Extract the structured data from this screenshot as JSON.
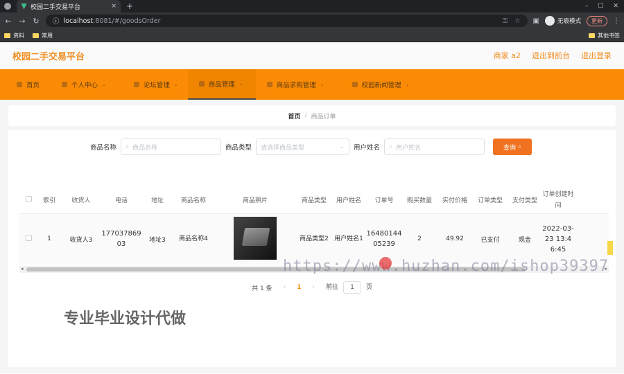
{
  "browser": {
    "tab_title": "校园二手交易平台",
    "tab_close": "×",
    "new_tab": "+",
    "url_host": "localhost",
    "url_path": ":8081/#/goodsOrder",
    "incognito": "无痕模式",
    "update": "更新",
    "bookmarks": [
      "资料",
      "常用"
    ],
    "other_bookmarks": "其他书签"
  },
  "header": {
    "title": "校园二手交易平台",
    "user": "商家 a2",
    "back_front": "退出到前台",
    "logout": "退出登录"
  },
  "nav": [
    {
      "label": "首页"
    },
    {
      "label": "个人中心"
    },
    {
      "label": "论坛管理"
    },
    {
      "label": "商品管理"
    },
    {
      "label": "商品求购管理"
    },
    {
      "label": "校园新闻管理"
    }
  ],
  "breadcrumb": {
    "home": "首页",
    "sep": "/",
    "current": "商品订单"
  },
  "filters": {
    "goods_name_label": "商品名称",
    "goods_name_placeholder": "商品名称",
    "goods_type_label": "商品类型",
    "goods_type_placeholder": "请选择商品类型",
    "user_name_label": "用户姓名",
    "user_name_placeholder": "用户姓名",
    "query_button": "查询"
  },
  "table": {
    "columns": [
      "索引",
      "收货人",
      "电话",
      "地址",
      "商品名称",
      "商品照片",
      "商品类型",
      "用户姓名",
      "订单号",
      "购买数量",
      "实付价格",
      "订单类型",
      "支付类型",
      "订单创建时间"
    ],
    "rows": [
      {
        "index": "1",
        "receiver": "收货人3",
        "phone": "17703786903",
        "address": "地址3",
        "goods_name": "商品名称4",
        "goods_type": "商品类型2",
        "user_name": "用户姓名1",
        "order_no": "1648014405239",
        "quantity": "2",
        "price": "49.92",
        "order_type": "已支付",
        "pay_type": "现金",
        "created": "2022-03-23 13:46:45"
      }
    ]
  },
  "pager": {
    "total": "共 1 条",
    "prev": "‹",
    "current_page": "1",
    "next": "›",
    "goto": "前往",
    "page_value": "1",
    "page_suffix": "页"
  },
  "overlay_text": "专业毕业设计代做",
  "watermark": "https://www.huzhan.com/ishop39397"
}
